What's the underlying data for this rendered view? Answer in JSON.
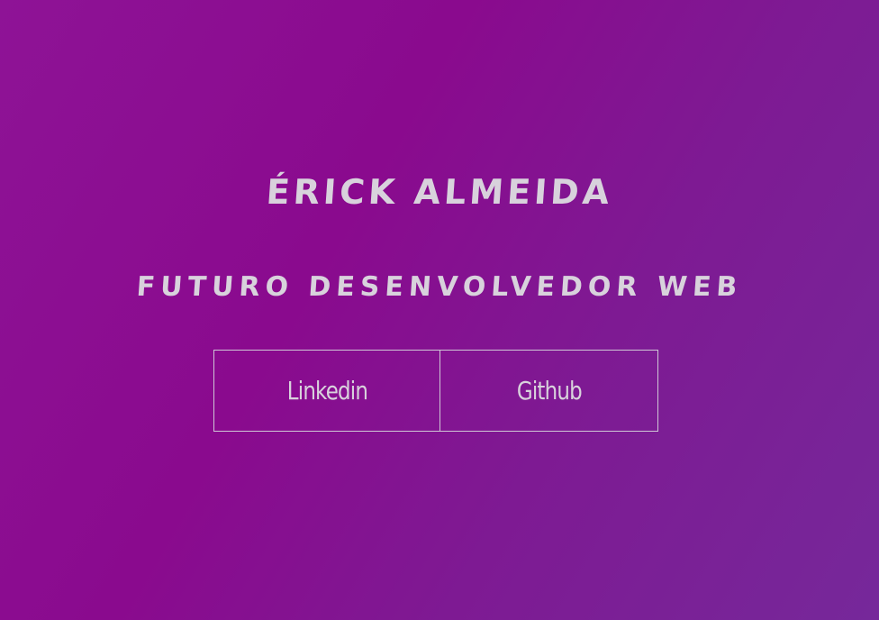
{
  "hero": {
    "name": "ÉRICK ALMEIDA",
    "role": "FUTURO DESENVOLVEDOR WEB"
  },
  "links": {
    "linkedin_label": "Linkedin",
    "github_label": "Github"
  },
  "colors": {
    "background_start": "#8e1396",
    "background_end": "#76289a",
    "text": "#d8d2dc",
    "border": "#cfc6d6"
  }
}
